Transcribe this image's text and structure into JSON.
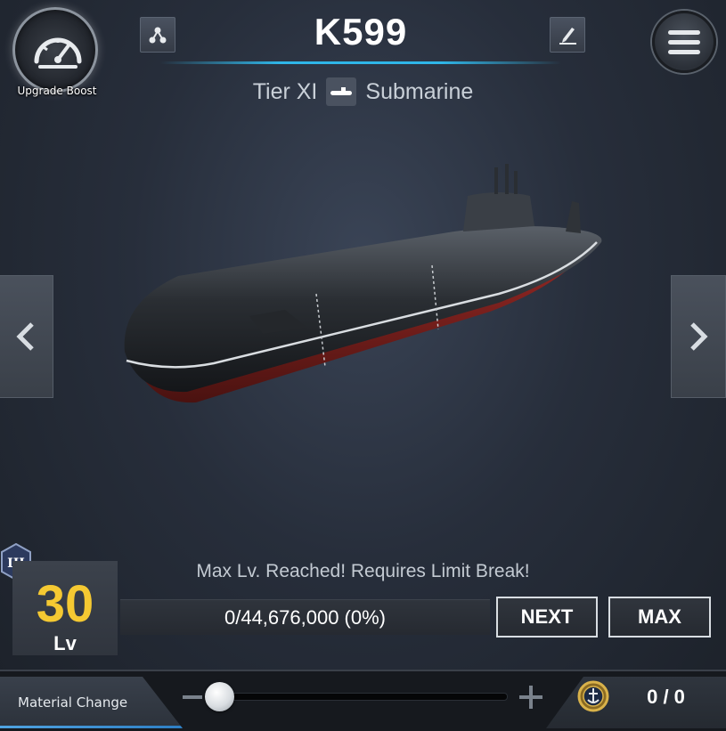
{
  "header": {
    "boost_label": "Upgrade Boost",
    "ship_name": "K599",
    "tier": "Tier XI",
    "ship_type": "Submarine",
    "accent": "#2fb6e8"
  },
  "level": {
    "tier_badge": "III",
    "value": "30",
    "unit": "Lv",
    "status_message": "Max Lv. Reached! Requires Limit Break!",
    "xp_text": "0/44,676,000 (0%)",
    "xp_progress": 0,
    "level_color": "#f5c932"
  },
  "buttons": {
    "next_label": "NEXT",
    "max_label": "MAX"
  },
  "bottom_bar": {
    "material_change_label": "Material Change",
    "slider_value": 0,
    "material_count": "0 / 0"
  },
  "icons": {
    "boost": "speedometer-icon",
    "tree": "tree-icon",
    "edit": "pencil-icon",
    "menu": "hamburger-icon",
    "prev": "chevron-left-icon",
    "next": "chevron-right-icon",
    "type": "submarine-icon",
    "material": "material-medal-icon"
  }
}
